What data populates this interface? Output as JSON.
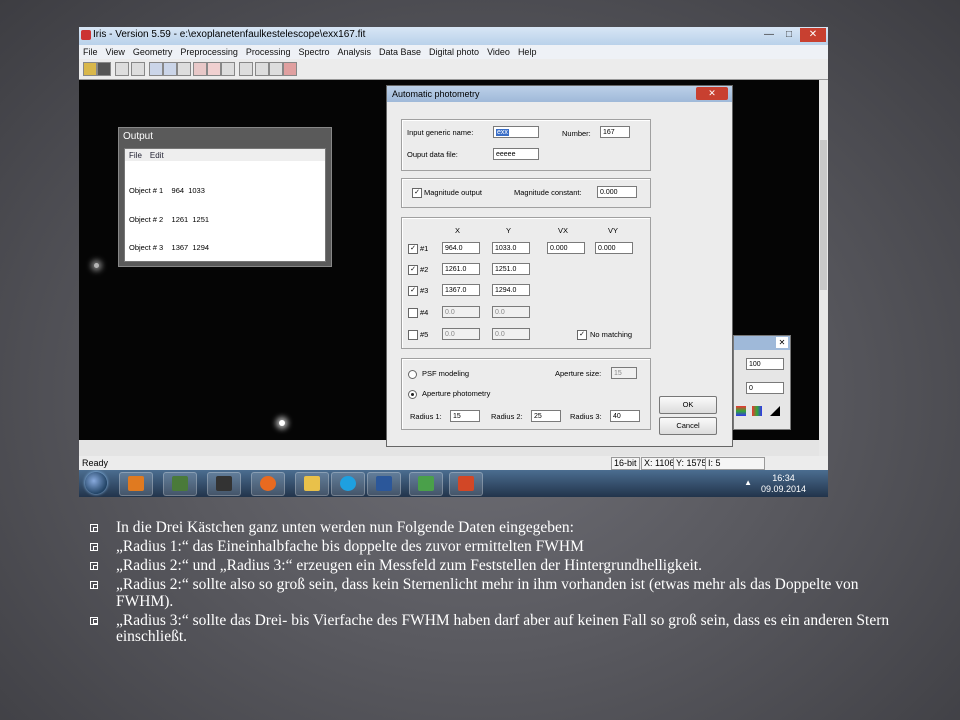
{
  "window": {
    "title": "Iris - Version 5.59 - e:\\exoplanetenfaulkestelescope\\exx167.fit",
    "controls": [
      "—",
      "□",
      "✕"
    ]
  },
  "menu": [
    "File",
    "View",
    "Geometry",
    "Preprocessing",
    "Processing",
    "Spectro",
    "Analysis",
    "Data Base",
    "Digital photo",
    "Video",
    "Help"
  ],
  "output_window": {
    "title": "Output",
    "menu": [
      "File",
      "Edit"
    ],
    "lines": [
      "Object # 1    964  1033",
      "Object # 2    1261  1251",
      "Object # 3    1367  1294"
    ]
  },
  "dialog": {
    "title": "Automatic photometry",
    "close": "✕",
    "generic_name_label": "Input generic name:",
    "generic_name_value": "exx",
    "number_label": "Number:",
    "number_value": "167",
    "output_file_label": "Ouput data file:",
    "output_file_value": "eeeee",
    "mag_output_label": "Magnitude output",
    "mag_output_checked": true,
    "mag_constant_label": "Magnitude constant:",
    "mag_constant_value": "0.000",
    "col_headers": [
      "X",
      "Y",
      "VX",
      "VY"
    ],
    "objects": [
      {
        "label": "#1",
        "checked": true,
        "x": "964.0",
        "y": "1033.0",
        "vx": "0.000",
        "vy": "0.000",
        "enabled": true
      },
      {
        "label": "#2",
        "checked": true,
        "x": "1261.0",
        "y": "1251.0",
        "enabled": true
      },
      {
        "label": "#3",
        "checked": true,
        "x": "1367.0",
        "y": "1294.0",
        "enabled": true
      },
      {
        "label": "#4",
        "checked": false,
        "x": "0.0",
        "y": "0.0",
        "enabled": false
      },
      {
        "label": "#5",
        "checked": false,
        "x": "0.0",
        "y": "0.0",
        "enabled": false
      }
    ],
    "no_matching_label": "No matching",
    "no_matching_checked": true,
    "psf_label": "PSF modeling",
    "aperture_photometry_label": "Aperture photometry",
    "aperture_size_label": "Aperture size:",
    "aperture_size_value": "15",
    "radius1_label": "Radius 1:",
    "radius1_value": "15",
    "radius2_label": "Radius 2:",
    "radius2_value": "25",
    "radius3_label": "Radius 3:",
    "radius3_value": "40",
    "ok_label": "OK",
    "cancel_label": "Cancel"
  },
  "small_dialog": {
    "close": "✕",
    "value1": "100",
    "value2": "0"
  },
  "status": {
    "ready": "Ready",
    "bits": "16-bit",
    "x": "X: 1106",
    "y": "Y: 1575",
    "i": "I: 5"
  },
  "taskbar": {
    "tray_arrow": "▲",
    "time": "16:34",
    "date": "09.09.2014"
  },
  "bullets": [
    "In die Drei Kästchen ganz unten werden nun Folgende Daten eingegeben:",
    "„Radius 1:“ das Eineinhalbfache bis doppelte des zuvor ermittelten FWHM",
    "„Radius 2:“ und „Radius 3:“ erzeugen ein Messfeld zum Feststellen der Hintergrundhelligkeit.",
    "„Radius 2:“ sollte also so groß sein, dass kein Sternenlicht mehr in ihm vorhanden ist (etwas mehr als das Doppelte von FWHM).",
    "„Radius 3:“ sollte das Drei- bis Vierfache des FWHM haben darf aber auf keinen Fall so groß sein, dass es ein anderen Stern einschließt."
  ],
  "colors": {
    "slide_background": "#5a5a60",
    "titlebar": "#c8dbef",
    "close_button": "#c84030",
    "selection": "#3a6ec7"
  }
}
